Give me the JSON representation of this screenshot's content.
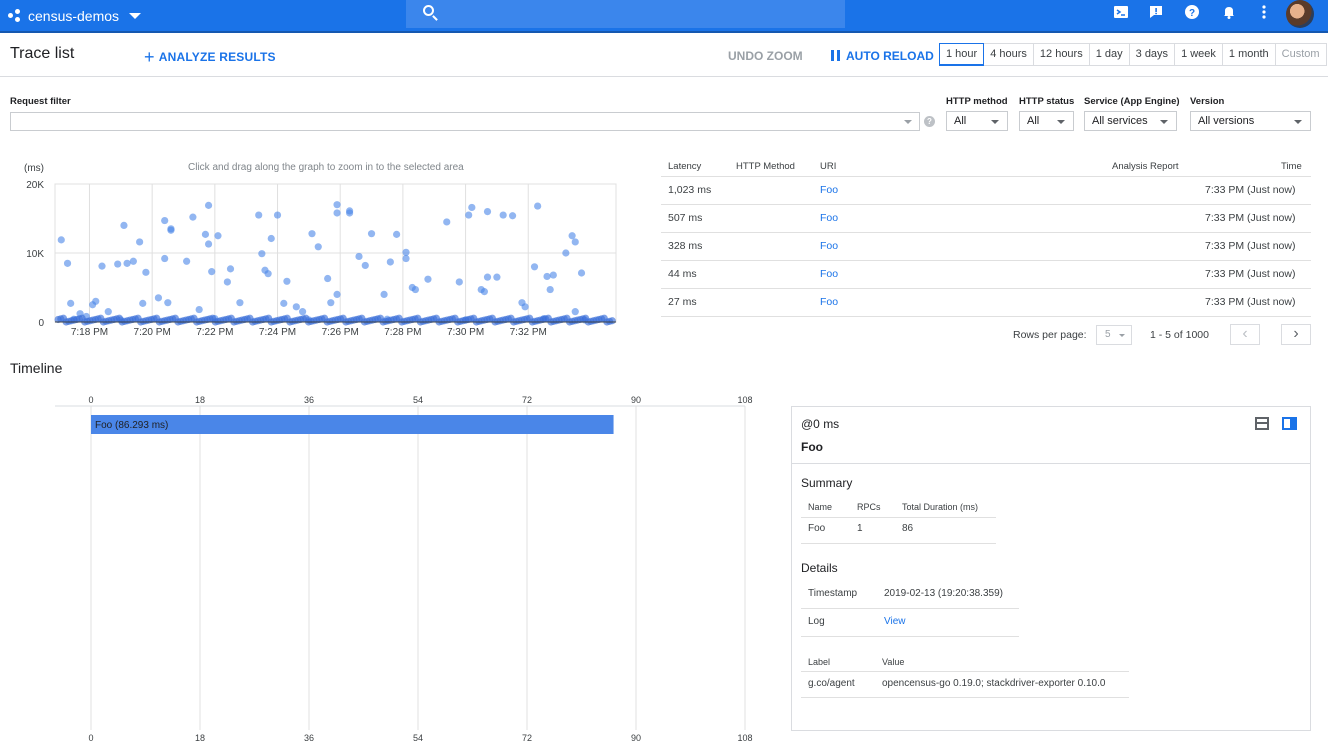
{
  "topbar": {
    "project": "census-demos",
    "icons": [
      "cloud-shell-icon",
      "feedback-icon",
      "help-icon",
      "notifications-icon",
      "more-vert-icon"
    ]
  },
  "header": {
    "title": "Trace list",
    "analyze_label": "ANALYZE RESULTS",
    "undo_zoom_label": "UNDO ZOOM",
    "auto_reload_label": "AUTO RELOAD",
    "ranges": [
      "1 hour",
      "4 hours",
      "12 hours",
      "1 day",
      "3 days",
      "1 week",
      "1 month",
      "Custom"
    ],
    "active_range": "1 hour"
  },
  "filters": {
    "request_filter_label": "Request filter",
    "request_filter_value": "",
    "http_method_label": "HTTP method",
    "http_method_value": "All",
    "http_status_label": "HTTP status",
    "http_status_value": "All",
    "service_label": "Service (App Engine)",
    "service_value": "All services",
    "version_label": "Version",
    "version_value": "All versions"
  },
  "chart_data": {
    "type": "scatter",
    "hint": "Click and drag along the graph to zoom in to the selected area",
    "ylabel": "(ms)",
    "yticks": [
      "20K",
      "10K",
      "0"
    ],
    "ylim": [
      0,
      20000
    ],
    "xticks": [
      "7:18 PM",
      "7:20 PM",
      "7:22 PM",
      "7:24 PM",
      "7:26 PM",
      "7:28 PM",
      "7:30 PM",
      "7:32 PM"
    ],
    "xlim_minutes": [
      16.9,
      34.8
    ],
    "tick_minutes": [
      18,
      20,
      22,
      24,
      26,
      28,
      30,
      32
    ],
    "grid": true,
    "points": [
      [
        17.1,
        11900
      ],
      [
        17.3,
        8500
      ],
      [
        17.4,
        2700
      ],
      [
        17.7,
        1200
      ],
      [
        17.9,
        800
      ],
      [
        18.1,
        2500
      ],
      [
        18.2,
        3000
      ],
      [
        18.4,
        8100
      ],
      [
        18.6,
        1500
      ],
      [
        18.9,
        8400
      ],
      [
        19.1,
        14000
      ],
      [
        19.2,
        8500
      ],
      [
        19.4,
        8800
      ],
      [
        19.6,
        11600
      ],
      [
        19.7,
        2700
      ],
      [
        19.8,
        7200
      ],
      [
        20.2,
        3500
      ],
      [
        20.4,
        14700
      ],
      [
        20.4,
        9200
      ],
      [
        20.5,
        2800
      ],
      [
        20.6,
        13500
      ],
      [
        20.6,
        13300
      ],
      [
        21.1,
        8800
      ],
      [
        21.3,
        15200
      ],
      [
        21.5,
        1800
      ],
      [
        21.7,
        12700
      ],
      [
        21.8,
        16900
      ],
      [
        21.8,
        11300
      ],
      [
        21.9,
        7300
      ],
      [
        22.1,
        12500
      ],
      [
        22.4,
        5800
      ],
      [
        22.5,
        7700
      ],
      [
        22.8,
        2800
      ],
      [
        23.4,
        15500
      ],
      [
        23.5,
        9900
      ],
      [
        23.6,
        7500
      ],
      [
        23.7,
        7000
      ],
      [
        23.8,
        12100
      ],
      [
        24.0,
        15500
      ],
      [
        24.3,
        5900
      ],
      [
        24.2,
        2700
      ],
      [
        24.6,
        2200
      ],
      [
        24.8,
        1500
      ],
      [
        25.1,
        12800
      ],
      [
        25.3,
        10900
      ],
      [
        25.6,
        6300
      ],
      [
        25.7,
        2800
      ],
      [
        25.9,
        4000
      ],
      [
        25.9,
        15800
      ],
      [
        25.9,
        17000
      ],
      [
        26.3,
        16100
      ],
      [
        26.3,
        15800
      ],
      [
        26.6,
        9500
      ],
      [
        26.8,
        8200
      ],
      [
        27.0,
        12800
      ],
      [
        27.4,
        4000
      ],
      [
        27.6,
        8700
      ],
      [
        27.8,
        12700
      ],
      [
        28.1,
        10100
      ],
      [
        28.1,
        9200
      ],
      [
        28.3,
        5000
      ],
      [
        28.4,
        4700
      ],
      [
        28.8,
        6200
      ],
      [
        29.4,
        14500
      ],
      [
        29.8,
        5800
      ],
      [
        30.1,
        15500
      ],
      [
        30.2,
        16600
      ],
      [
        30.5,
        4700
      ],
      [
        30.6,
        4400
      ],
      [
        30.7,
        16000
      ],
      [
        30.7,
        6500
      ],
      [
        31.0,
        6500
      ],
      [
        31.2,
        15500
      ],
      [
        31.5,
        15400
      ],
      [
        31.8,
        2800
      ],
      [
        31.9,
        2200
      ],
      [
        32.2,
        8000
      ],
      [
        32.3,
        16800
      ],
      [
        32.6,
        6600
      ],
      [
        32.7,
        4700
      ],
      [
        32.8,
        6800
      ],
      [
        33.2,
        10000
      ],
      [
        33.4,
        12500
      ],
      [
        33.5,
        11600
      ],
      [
        33.7,
        7100
      ],
      [
        33.5,
        1500
      ],
      [
        17.5,
        400
      ],
      [
        19.0,
        300
      ],
      [
        22.0,
        500
      ],
      [
        25.0,
        300
      ],
      [
        27.5,
        400
      ],
      [
        30.0,
        300
      ],
      [
        32.5,
        500
      ],
      [
        33.8,
        300
      ]
    ]
  },
  "trace_table": {
    "headers": [
      "Latency",
      "HTTP Method",
      "URI",
      "Analysis Report",
      "Time"
    ],
    "rows": [
      {
        "latency": "1,023 ms",
        "method": "",
        "uri": "Foo",
        "report": "",
        "time": "7:33 PM  (Just now)"
      },
      {
        "latency": "507 ms",
        "method": "",
        "uri": "Foo",
        "report": "",
        "time": "7:33 PM  (Just now)"
      },
      {
        "latency": "328 ms",
        "method": "",
        "uri": "Foo",
        "report": "",
        "time": "7:33 PM  (Just now)"
      },
      {
        "latency": "44 ms",
        "method": "",
        "uri": "Foo",
        "report": "",
        "time": "7:33 PM  (Just now)"
      },
      {
        "latency": "27 ms",
        "method": "",
        "uri": "Foo",
        "report": "",
        "time": "7:33 PM  (Just now)"
      }
    ],
    "rows_per_page_label": "Rows per page:",
    "rows_per_page": "5",
    "range_text": "1 - 5 of 1000"
  },
  "timeline": {
    "title": "Timeline",
    "ticks": [
      "0",
      "18",
      "36",
      "54",
      "72",
      "90",
      "108"
    ],
    "tick_values": [
      0,
      18,
      36,
      54,
      72,
      90,
      108
    ],
    "span_label": "Foo (86.293 ms)",
    "span_start_ms": 0,
    "span_duration_ms": 86.293
  },
  "details": {
    "at": "@0 ms",
    "name": "Foo",
    "summary_title": "Summary",
    "summary_headers": [
      "Name",
      "RPCs",
      "Total Duration (ms)"
    ],
    "summary_row": [
      "Foo",
      "1",
      "86"
    ],
    "details_title": "Details",
    "timestamp_label": "Timestamp",
    "timestamp_value": "2019-02-13 (19:20:38.359)",
    "log_label": "Log",
    "log_value": "View",
    "label_header": "Label",
    "value_header": "Value",
    "label_key": "g.co/agent",
    "label_value": "opencensus-go 0.19.0; stackdriver-exporter 0.10.0"
  },
  "colors": {
    "brand": "#1a73e8",
    "point": "#4a86e8"
  }
}
